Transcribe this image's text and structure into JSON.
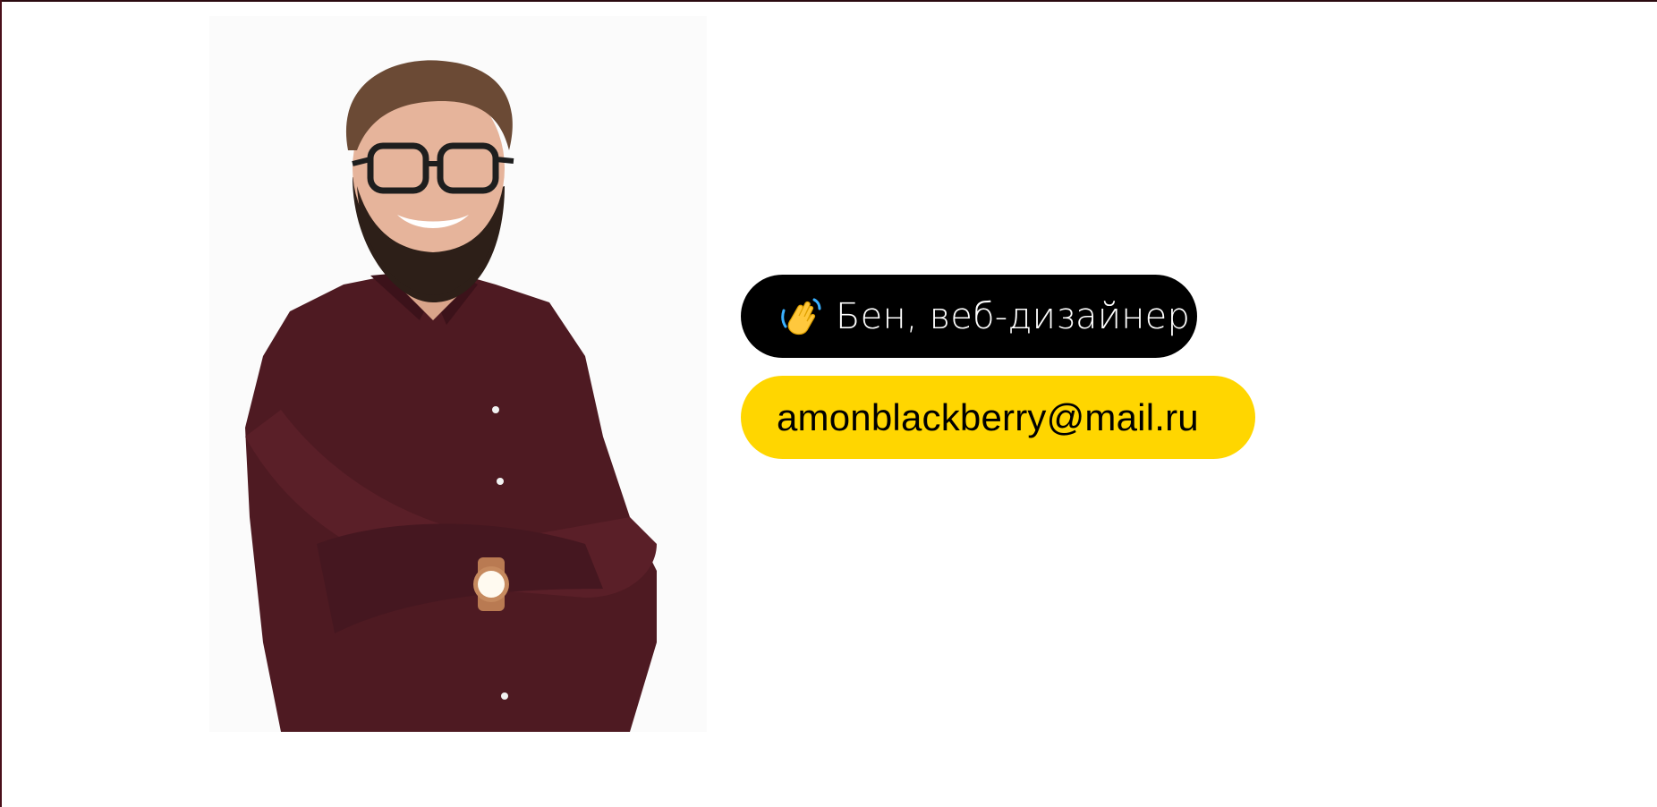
{
  "profile": {
    "portrait_description_icon": "person-photo",
    "name_badge": {
      "icon": "waving-hand-icon",
      "text": "Бен, веб-дизайнер"
    },
    "email_badge": {
      "text": "amonblackberry@mail.ru"
    }
  },
  "colors": {
    "background": "#ffffff",
    "name_pill_bg": "#000000",
    "name_pill_text": "#ffffff",
    "email_pill_bg": "#ffd600",
    "email_pill_text": "#000000",
    "shirt": "#4e1a22"
  }
}
